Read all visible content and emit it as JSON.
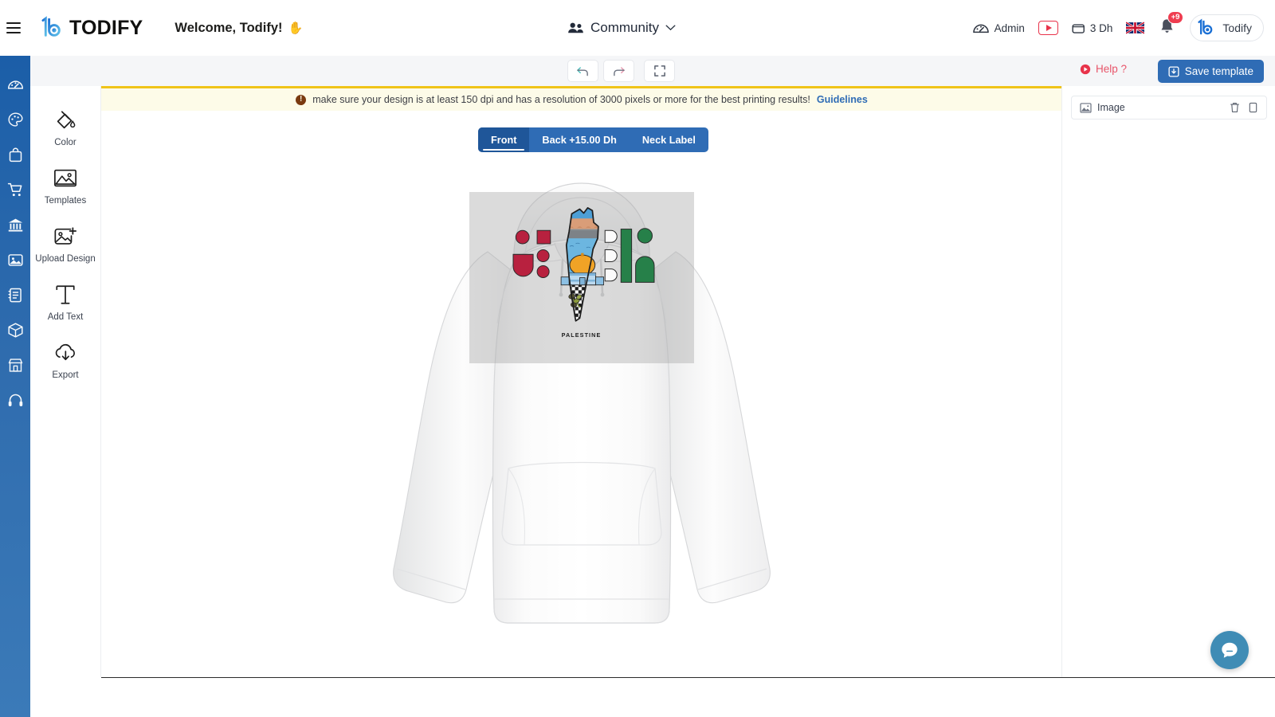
{
  "header": {
    "menu_icon": "hamburger-icon",
    "logo_text": "TODIFY",
    "welcome_text": "Welcome, Todify!",
    "wave_emoji": "✋",
    "community": {
      "label": "Community",
      "icon": "users-icon",
      "chevron": "chevron-down-icon"
    },
    "admin": {
      "label": "Admin",
      "icon": "speedometer-icon"
    },
    "video_button": "youtube-play-button",
    "balance": {
      "label": "3 Dh",
      "icon": "wallet-icon"
    },
    "language": {
      "icon": "uk-flag-icon"
    },
    "notifications": {
      "icon": "bell-icon",
      "badge": "+9"
    },
    "profile": {
      "name": "Todify",
      "avatar": "todify-logo-avatar"
    }
  },
  "subbar": {
    "undo": "undo-icon",
    "redo": "redo-icon",
    "fullscreen": "fullscreen-icon",
    "help_label": "Help ?",
    "save_label": "Save template"
  },
  "rail": {
    "items": [
      {
        "name": "dashboard",
        "icon": "speedometer-icon"
      },
      {
        "name": "design",
        "icon": "palette-icon"
      },
      {
        "name": "products",
        "icon": "bag-icon"
      },
      {
        "name": "orders",
        "icon": "cart-icon"
      },
      {
        "name": "payments",
        "icon": "bank-icon"
      },
      {
        "name": "media",
        "icon": "image-icon"
      },
      {
        "name": "invoices",
        "icon": "notebook-icon"
      },
      {
        "name": "shipping",
        "icon": "box-icon"
      },
      {
        "name": "store",
        "icon": "storefront-icon"
      },
      {
        "name": "support",
        "icon": "headset-icon"
      }
    ]
  },
  "tools": [
    {
      "label": "Color",
      "icon": "paint-bucket-icon"
    },
    {
      "label": "Templates",
      "icon": "image-icon"
    },
    {
      "label": "Upload Design",
      "icon": "image-plus-icon"
    },
    {
      "label": "Add Text",
      "icon": "text-t-icon"
    },
    {
      "label": "Export",
      "icon": "cloud-download-icon"
    }
  ],
  "notice": {
    "icon": "warning-icon",
    "text": "make sure your design is at least 150 dpi and has a resolution of 3000 pixels or more for the best printing results!",
    "link": "Guidelines"
  },
  "view_tabs": [
    {
      "label": "Front",
      "active": true
    },
    {
      "label": "Back +15.00 Dh",
      "active": false
    },
    {
      "label": "Neck Label",
      "active": false
    }
  ],
  "design": {
    "product": "white-hoodie-mockup",
    "artwork_name": "palestine-map-artwork",
    "caption": "PALESTINE"
  },
  "right_panel": {
    "layers": [
      {
        "name": "Image",
        "icon": "image-icon",
        "delete": "trash-icon",
        "duplicate": "copy-icon"
      }
    ]
  },
  "chat": {
    "icon": "chat-bubble-icon"
  },
  "colors": {
    "brand_blue": "#2f6cb5",
    "rail_blue": "#1b5ea8",
    "notice_bg": "#fdfbe8",
    "notice_border": "#f0c419",
    "help_red": "#e8556a",
    "badge_red": "#ef3d50",
    "chat_blue": "#3f8cb5"
  }
}
